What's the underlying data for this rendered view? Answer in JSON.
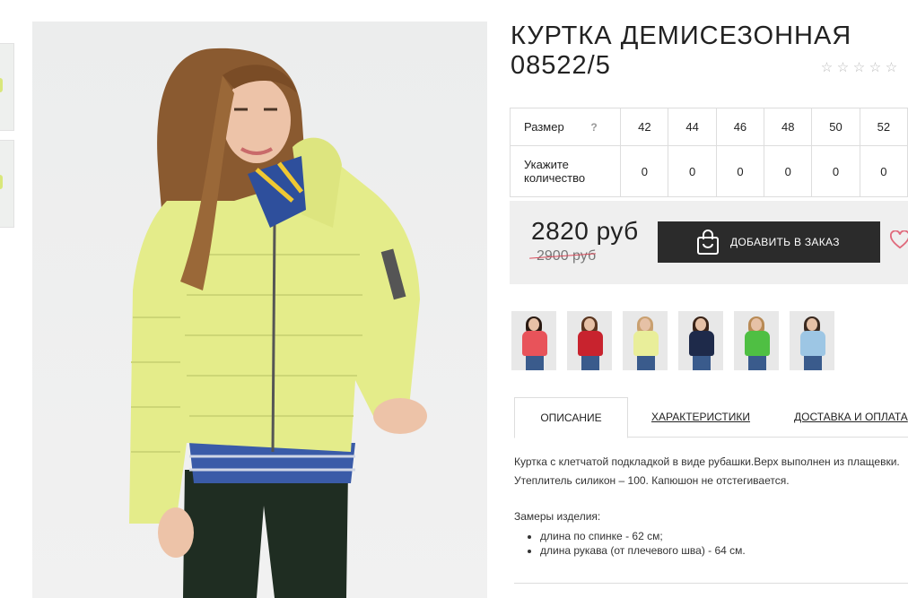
{
  "product": {
    "title": "КУРТКА ДЕМИСЕЗОННАЯ 08522/5",
    "rating_stars": 5,
    "rating_value": 0
  },
  "sizes": {
    "size_label": "Размер",
    "help": "?",
    "qty_label": "Укажите количество",
    "values": [
      "42",
      "44",
      "46",
      "48",
      "50",
      "52"
    ],
    "quantities": [
      "0",
      "0",
      "0",
      "0",
      "0",
      "0"
    ]
  },
  "price": {
    "current": "2820 руб",
    "old": "2900 руб"
  },
  "actions": {
    "add_to_order": "ДОБАВИТЬ В ЗАКАЗ"
  },
  "colors": {
    "variants": [
      "#e8535a",
      "#c8232e",
      "#e9ee9a",
      "#1e2a4a",
      "#4fbf43",
      "#9dc6e4"
    ]
  },
  "tabs": [
    "ОПИСАНИЕ",
    "ХАРАКТЕРИСТИКИ",
    "ДОСТАВКА И ОПЛАТА"
  ],
  "description": {
    "text": "Куртка с клетчатой подкладкой в виде рубашки.Верх выполнен из плащевки. Утеплитель силикон – 100. Капюшон не отстегивается.",
    "measurements_title": "Замеры изделия:",
    "measurements": [
      "длина по спинке - 62 см;",
      "длина рукава (от плечевого шва) - 64 см."
    ]
  },
  "colors_theme": {
    "accent_dark": "#2b2b2b",
    "price_bg": "#efefef",
    "old_price_strike": "#d84a5a",
    "heart": "#e06a7c"
  }
}
